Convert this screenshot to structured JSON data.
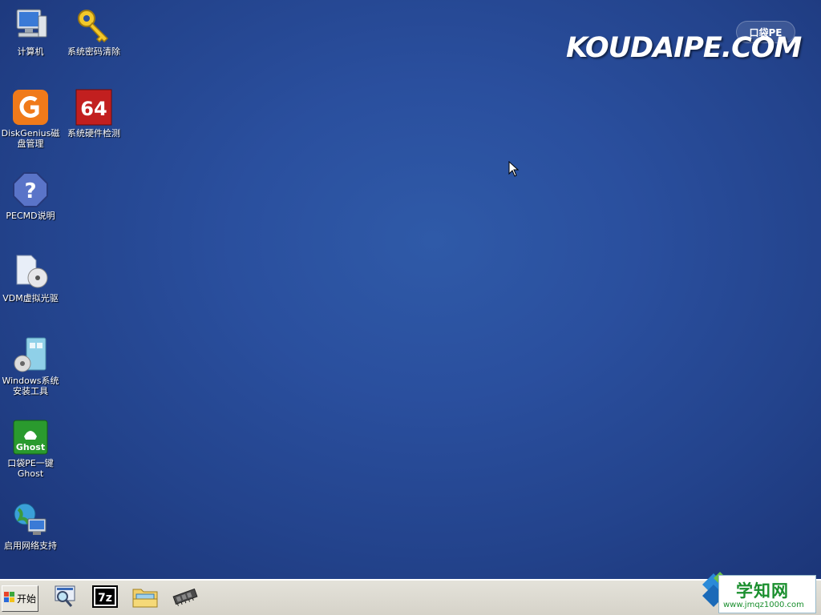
{
  "desktop": {
    "icons": [
      {
        "label": "计算机",
        "icon": "computer-icon"
      },
      {
        "label": "系统密码清除",
        "icon": "key-icon"
      },
      {
        "label": "DiskGenius磁\n盘管理",
        "icon": "diskgenius-icon"
      },
      {
        "label": "系统硬件检测",
        "icon": "aida64-icon"
      },
      {
        "label": "PECMD说明",
        "icon": "help-icon"
      },
      {
        "label": "VDM虚拟光驱",
        "icon": "virtual-drive-icon"
      },
      {
        "label": "Windows系统\n安装工具",
        "icon": "windows-installer-icon"
      },
      {
        "label": "口袋PE一键\nGhost",
        "icon": "ghost-icon"
      },
      {
        "label": "启用网络支持",
        "icon": "network-icon"
      }
    ]
  },
  "logo": {
    "brand": "KOUDAIPE.COM",
    "badge": "口袋PE"
  },
  "taskbar": {
    "start_label": "开始",
    "quick_launch": [
      {
        "icon": "search-icon"
      },
      {
        "icon": "7zip-icon",
        "text": "7z"
      },
      {
        "icon": "explorer-icon"
      },
      {
        "icon": "memory-chip-icon"
      }
    ]
  },
  "watermark": {
    "title": "学知网",
    "url": "www.jmqz1000.com"
  },
  "colors": {
    "desktop": "#2a4f9e",
    "taskbar": "#d6d3c9",
    "accent_green": "#1a8f2e"
  }
}
